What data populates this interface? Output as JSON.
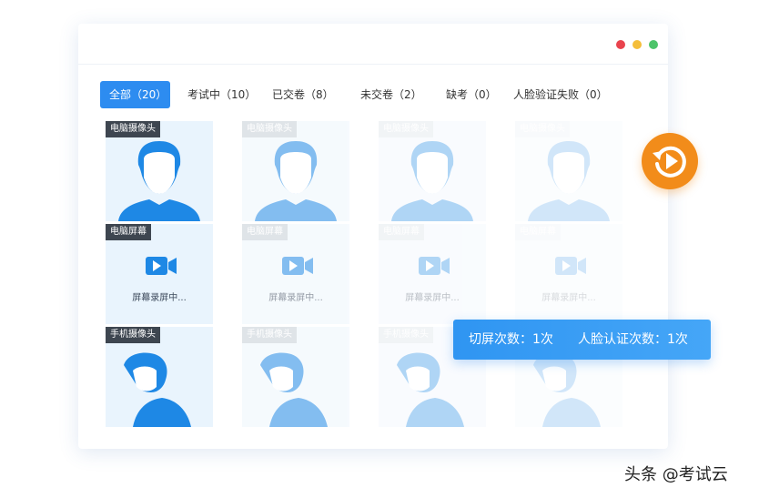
{
  "tabs": [
    {
      "label": "全部（20）",
      "active": true
    },
    {
      "label": "考试中（10）",
      "active": false
    },
    {
      "label": "已交卷（8）",
      "active": false
    },
    {
      "label": "未交卷（2）",
      "active": false
    },
    {
      "label": "缺考（0）",
      "active": false
    },
    {
      "label": "人脸验证失败（0）",
      "active": false
    }
  ],
  "rows": [
    {
      "label": "电脑摄像头",
      "kind": "computer-camera"
    },
    {
      "label": "电脑屏幕",
      "kind": "computer-screen",
      "caption": "屏幕录屏中..."
    },
    {
      "label": "手机摄像头",
      "kind": "phone-camera"
    }
  ],
  "stats": {
    "switch_screen": "切屏次数：1次",
    "face_verify": "人脸认证次数：1次"
  },
  "replay_icon": "replay-icon",
  "watermark": "头条 @考试云",
  "colors": {
    "accent": "#2d8cf0",
    "avatar": "#1e88e5",
    "replay": "#f28c1a",
    "window_red": "#e9434d",
    "window_yellow": "#f4be3a",
    "window_green": "#4cc46a"
  }
}
